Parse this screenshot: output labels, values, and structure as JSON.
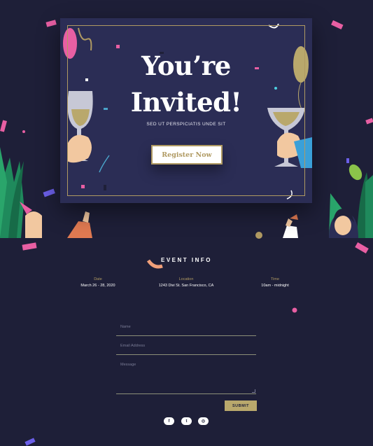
{
  "hero": {
    "title_line1": "You’re",
    "title_line2": "Invited!",
    "subtitle": "SED UT PERSPICIATIS UNDE SIT",
    "register_label": "Register Now"
  },
  "event_info": {
    "heading": "EVENT INFO",
    "items": [
      {
        "label": "Date",
        "value": "March 26 - 28, 2020"
      },
      {
        "label": "Location",
        "value": "1243 Divi St. San Francisco, CA"
      },
      {
        "label": "Time",
        "value": "10am - midnight"
      }
    ]
  },
  "form": {
    "name_placeholder": "Name",
    "email_placeholder": "Email Address",
    "message_placeholder": "Message",
    "submit_label": "SUBMIT"
  },
  "social": {
    "facebook_glyph": "f",
    "twitter_glyph": "t",
    "instagram_glyph": "◎"
  },
  "colors": {
    "background": "#1e1f38",
    "card": "#2b2d55",
    "gold": "#b09a62",
    "confetti_pink": "#e85fa3"
  }
}
